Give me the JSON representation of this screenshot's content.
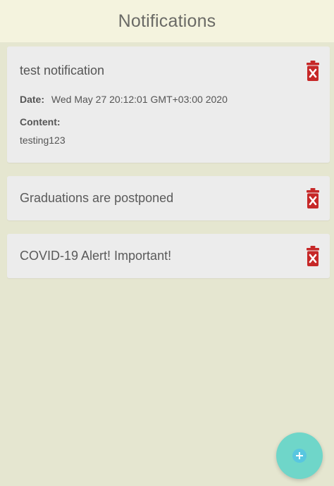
{
  "header": {
    "title": "Notifications"
  },
  "colors": {
    "header_bg": "#f4f3de",
    "page_bg": "#e5e6d0",
    "card_bg": "#ececec",
    "delete_red": "#c62828",
    "fab_teal": "#6fd6c9"
  },
  "notifications": [
    {
      "title": "test notification",
      "date_label": "Date:",
      "date_value": "Wed May 27 20:12:01 GMT+03:00 2020",
      "content_label": "Content:",
      "content_value": "testing123",
      "expanded": true
    },
    {
      "title": "Graduations are postponed",
      "expanded": false
    },
    {
      "title": "COVID-19 Alert! Important!",
      "expanded": false
    }
  ],
  "icons": {
    "delete": "trash-x-icon",
    "fab": "add-circle-icon"
  }
}
